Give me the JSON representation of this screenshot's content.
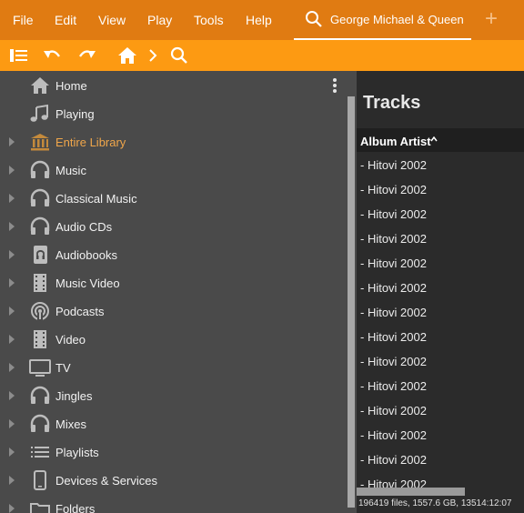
{
  "menu": {
    "file": "File",
    "edit": "Edit",
    "view": "View",
    "play": "Play",
    "tools": "Tools",
    "help": "Help"
  },
  "tab": {
    "label": "George Michael & Queen",
    "icon": "search-icon"
  },
  "add_tab": {
    "label": "+",
    "icon": "plus-icon"
  },
  "toolbar": {
    "icons": [
      "panel-toggle-icon",
      "undo-icon",
      "redo-icon",
      "home-icon",
      "chevron-right-icon",
      "search-icon"
    ]
  },
  "sidebar": {
    "items": [
      {
        "label": "Home",
        "icon": "home-icon",
        "expandable": false
      },
      {
        "label": "Playing",
        "icon": "music-note-icon",
        "expandable": false
      },
      {
        "label": "Entire Library",
        "icon": "library-icon",
        "expandable": true,
        "active": true
      },
      {
        "label": "Music",
        "icon": "headphones-icon",
        "expandable": true
      },
      {
        "label": "Classical Music",
        "icon": "headphones-icon",
        "expandable": true
      },
      {
        "label": "Audio CDs",
        "icon": "headphones-icon",
        "expandable": true
      },
      {
        "label": "Audiobooks",
        "icon": "audiobook-icon",
        "expandable": true
      },
      {
        "label": "Music Video",
        "icon": "film-icon",
        "expandable": true
      },
      {
        "label": "Podcasts",
        "icon": "podcast-icon",
        "expandable": true
      },
      {
        "label": "Video",
        "icon": "film-icon",
        "expandable": true
      },
      {
        "label": "TV",
        "icon": "tv-icon",
        "expandable": true
      },
      {
        "label": "Jingles",
        "icon": "headphones-icon",
        "expandable": true
      },
      {
        "label": "Mixes",
        "icon": "headphones-icon",
        "expandable": true
      },
      {
        "label": "Playlists",
        "icon": "playlist-icon",
        "expandable": true
      },
      {
        "label": "Devices & Services",
        "icon": "phone-icon",
        "expandable": true
      },
      {
        "label": "Folders",
        "icon": "folder-icon",
        "expandable": true
      }
    ]
  },
  "tracks": {
    "title": "Tracks",
    "column_header": "Album Artist",
    "sort": "ascending",
    "rows": [
      "- Hitovi 2002",
      "- Hitovi 2002",
      "- Hitovi 2002",
      "- Hitovi 2002",
      "- Hitovi 2002",
      "- Hitovi 2002",
      "- Hitovi 2002",
      "- Hitovi 2002",
      "- Hitovi 2002",
      "- Hitovi 2002",
      "- Hitovi 2002",
      "- Hitovi 2002",
      "- Hitovi 2002",
      "- Hitovi 2002"
    ]
  },
  "status": "196419 files, 1557.6 GB, 13514:12:07",
  "colors": {
    "menubar": "#e07b12",
    "toolbar": "#fd9a12",
    "active_item": "#f0a64a",
    "sidebar_bg": "#4a4a4a",
    "content_bg": "#2b2b2b"
  }
}
